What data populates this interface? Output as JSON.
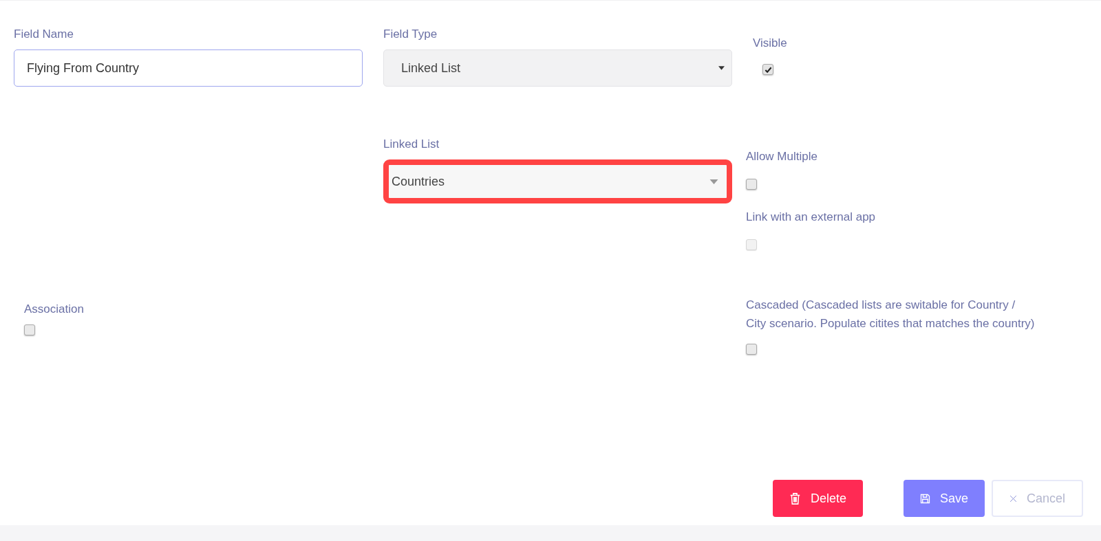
{
  "field_name": {
    "label": "Field Name",
    "value": "Flying From Country"
  },
  "field_type": {
    "label": "Field Type",
    "value": "Linked List"
  },
  "visible": {
    "label": "Visible",
    "checked": true,
    "disabled": false
  },
  "linked_list": {
    "label": "Linked List",
    "value": "Countries",
    "highlighted": true
  },
  "allow_multiple": {
    "label": "Allow Multiple",
    "checked": false,
    "disabled": false
  },
  "link_external": {
    "label": "Link with an external app",
    "checked": false,
    "disabled": true
  },
  "association": {
    "label": "Association",
    "checked": false,
    "disabled": false
  },
  "cascaded": {
    "label": "Cascaded (Cascaded lists are switable for Country / City scenario. Populate citites that matches the country)",
    "checked": false,
    "disabled": false
  },
  "buttons": [
    {
      "kind": "delete",
      "label": "Delete"
    },
    {
      "kind": "save",
      "label": "Save"
    },
    {
      "kind": "cancel",
      "label": "Cancel"
    }
  ]
}
